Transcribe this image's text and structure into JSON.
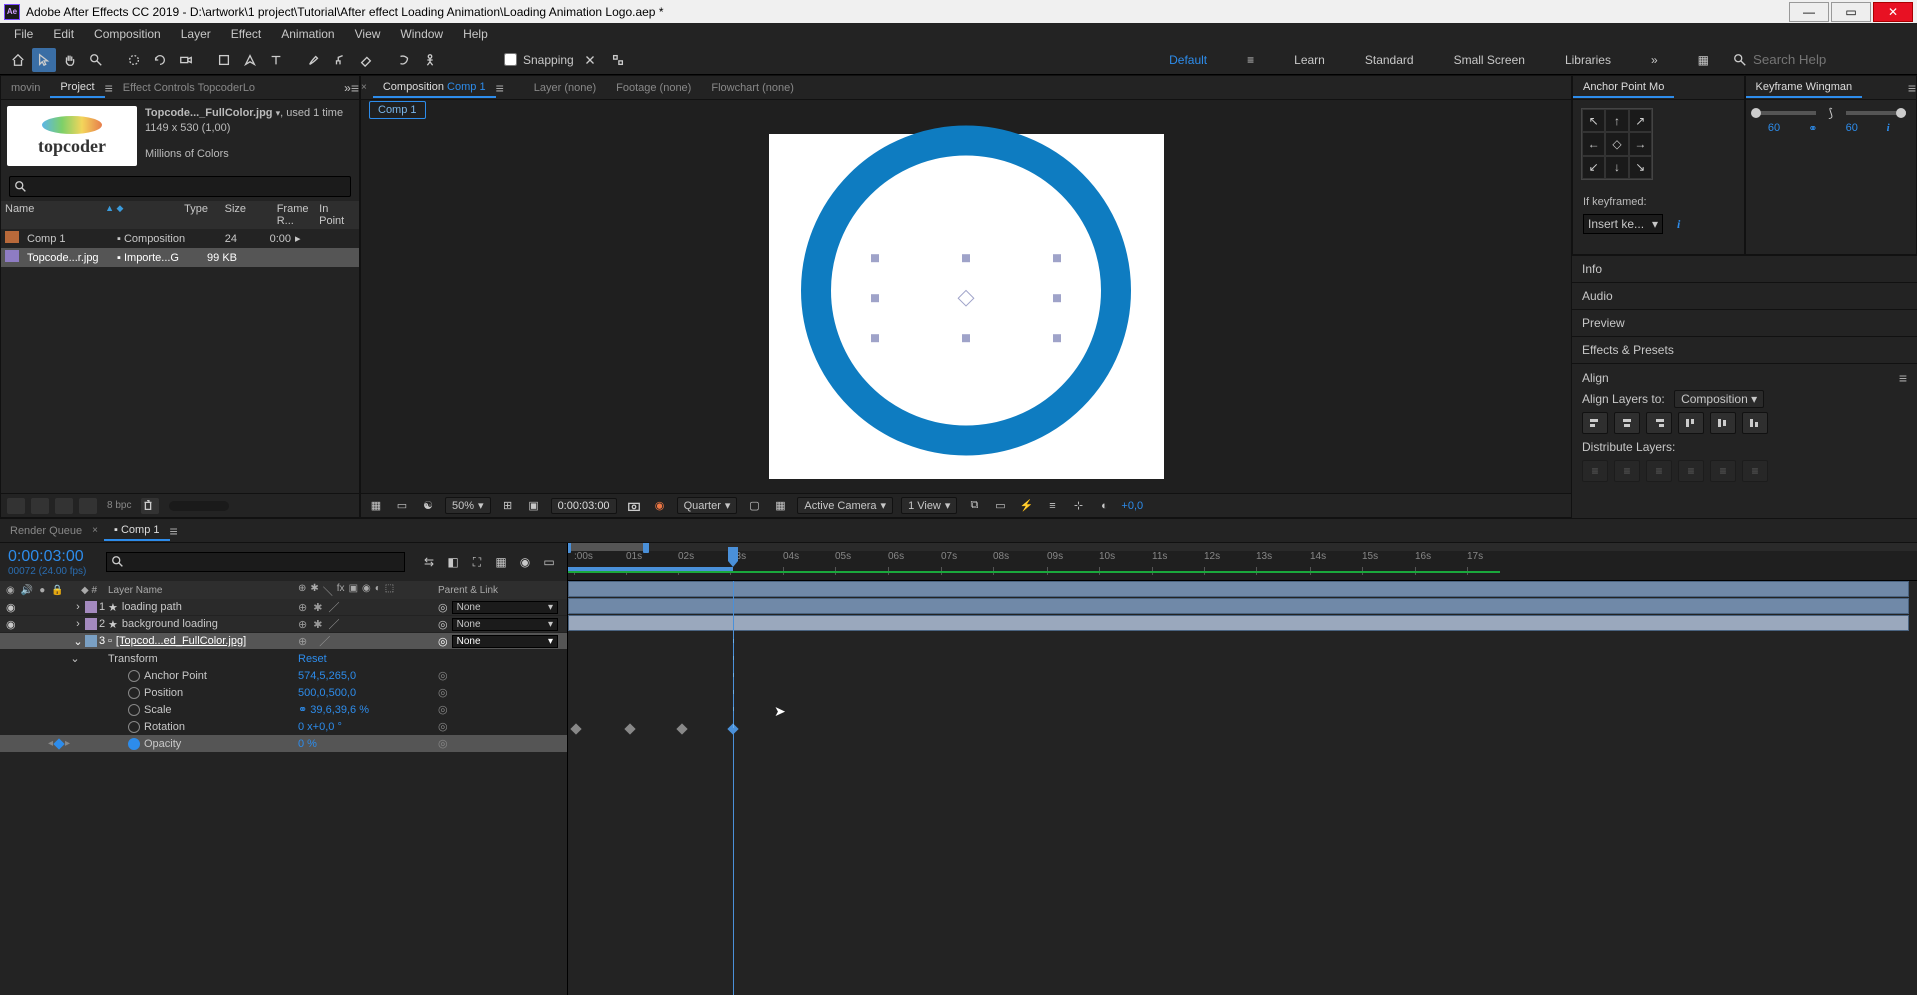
{
  "title": "Adobe After Effects CC 2019 - D:\\artwork\\1 project\\Tutorial\\After effect Loading Animation\\Loading Animation Logo.aep *",
  "menu": [
    "File",
    "Edit",
    "Composition",
    "Layer",
    "Effect",
    "Animation",
    "View",
    "Window",
    "Help"
  ],
  "snapping_label": "Snapping",
  "workspaces": {
    "items": [
      "Default",
      "Learn",
      "Standard",
      "Small Screen",
      "Libraries"
    ],
    "active": "Default"
  },
  "search_placeholder": "Search Help",
  "project_panel": {
    "tabs": [
      "movin",
      "Project",
      "Effect Controls TopcoderLo"
    ],
    "active_tab": "Project",
    "item_name": "Topcode..._FullColor.jpg",
    "used": ", used 1 time",
    "dims": "1149 x 530 (1,00)",
    "colors": "Millions of Colors",
    "columns": [
      "Name",
      "Type",
      "Size",
      "Frame R...",
      "In Point"
    ],
    "rows": [
      {
        "name": "Comp 1",
        "type": "Composition",
        "size": "24",
        "fr": "",
        "in": "0:00"
      },
      {
        "name": "Topcode...r.jpg",
        "type": "Importe...G",
        "size": "99 KB",
        "fr": "",
        "in": ""
      }
    ],
    "bpc": "8 bpc"
  },
  "comp_panel": {
    "tabs": [
      "Composition",
      "Layer  (none)",
      "Footage  (none)",
      "Flowchart  (none)"
    ],
    "comp_label_prefix": "Composition ",
    "comp_name": "Comp 1",
    "subtab": "Comp 1",
    "footer": {
      "mag": "50%",
      "time": "0:00:03:00",
      "res": "Quarter",
      "camera": "Active Camera",
      "view": "1 View",
      "exposure": "+0,0"
    }
  },
  "anchor_panel": {
    "title": "Anchor Point Mo",
    "kf_label": "If keyframed:",
    "kf_select": "Insert ke..."
  },
  "keyframe_wingman": {
    "title": "Keyframe Wingman",
    "left": "60",
    "right": "60"
  },
  "side_panels": [
    "Info",
    "Audio",
    "Preview",
    "Effects & Presets"
  ],
  "align": {
    "title": "Align",
    "layers_to_label": "Align Layers to:",
    "layers_to": "Composition",
    "distribute": "Distribute Layers:"
  },
  "timeline_tabs": [
    "Render Queue",
    "Comp 1"
  ],
  "timeline": {
    "time": "0:00:03:00",
    "time_sub": "00072 (24.00 fps)",
    "cols": {
      "name": "Layer Name",
      "parent": "Parent & Link",
      "num": "#"
    },
    "layers": [
      {
        "idx": "1",
        "name": "loading path",
        "parent": "None"
      },
      {
        "idx": "2",
        "name": "background loading",
        "parent": "None"
      },
      {
        "idx": "3",
        "name": "[Topcod...ed_FullColor.jpg]",
        "parent": "None"
      }
    ],
    "transform": "Transform",
    "reset": "Reset",
    "props": [
      {
        "label": "Anchor Point",
        "value": "574,5,265,0"
      },
      {
        "label": "Position",
        "value": "500,0,500,0"
      },
      {
        "label": "Scale",
        "value": "39,6,39,6 %"
      },
      {
        "label": "Rotation",
        "value": "0 x+0,0 °"
      },
      {
        "label": "Opacity",
        "value": "0 %"
      }
    ],
    "ruler": [
      ":00s",
      "01s",
      "02s",
      "03s",
      "04s",
      "05s",
      "06s",
      "07s",
      "08s",
      "09s",
      "10s",
      "11s",
      "12s",
      "13s",
      "14s",
      "15s",
      "16s",
      "17s"
    ]
  }
}
